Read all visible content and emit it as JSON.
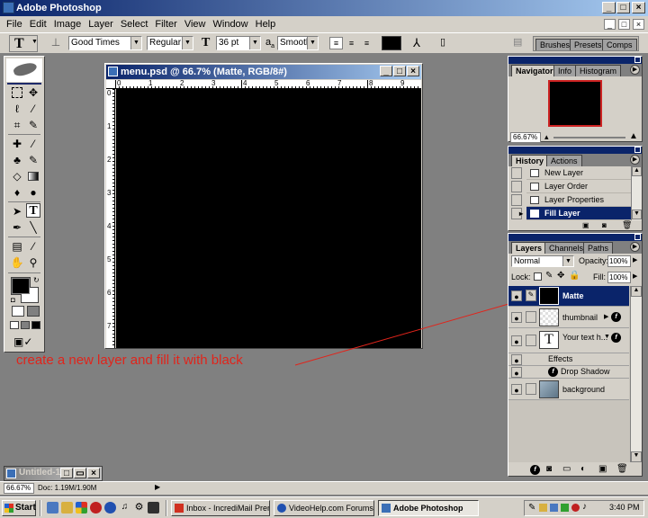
{
  "app": {
    "title": "Adobe Photoshop",
    "menu": [
      "File",
      "Edit",
      "Image",
      "Layer",
      "Select",
      "Filter",
      "View",
      "Window",
      "Help"
    ]
  },
  "options_bar": {
    "tool_glyph": "T",
    "font_family": "Good Times",
    "font_style": "Regular",
    "font_size": "36 pt",
    "aa_label": "a",
    "aa_sub": "a",
    "antialias": "Smooth",
    "text_color": "#000000",
    "palette_tabs": [
      "Brushes",
      "Presets",
      "Comps"
    ]
  },
  "document": {
    "title": "menu.psd @ 66.7% (Matte, RGB/8#)",
    "ruler_h": [
      "0",
      "1",
      "2",
      "3",
      "4",
      "5",
      "6",
      "7",
      "8",
      "9"
    ],
    "ruler_v": [
      "0",
      "1",
      "2",
      "3",
      "4",
      "5",
      "6",
      "7"
    ],
    "canvas_color": "#000000"
  },
  "minimized_doc": {
    "title": "Untitled-1"
  },
  "status_bar": {
    "zoom": "66.67%",
    "doc_size": "Doc: 1.19M/1.90M"
  },
  "annotation": {
    "text": "create a new layer and fill it with black",
    "color": "#e0241b"
  },
  "navigator": {
    "tabs": [
      "Navigator",
      "Info",
      "Histogram"
    ],
    "zoom": "66.67%"
  },
  "history": {
    "tabs": [
      "History",
      "Actions"
    ],
    "items": [
      "New Layer",
      "Layer Order",
      "Layer Properties",
      "Fill Layer"
    ],
    "active_index": 3
  },
  "layers": {
    "tabs": [
      "Layers",
      "Channels",
      "Paths"
    ],
    "blend_mode": "Normal",
    "opacity_label": "Opacity:",
    "opacity": "100%",
    "lock_label": "Lock:",
    "fill_label": "Fill:",
    "fill": "100%",
    "items": [
      {
        "name": "Matte",
        "selected": true
      },
      {
        "name": "thumbnail",
        "selected": false
      },
      {
        "name": "Your text h...",
        "selected": false
      },
      {
        "name": "Effects",
        "selected": false
      },
      {
        "name": "Drop Shadow",
        "selected": false
      },
      {
        "name": "background",
        "selected": false
      }
    ],
    "text_thumb_glyph": "T"
  },
  "taskbar": {
    "start": "Start",
    "buttons": [
      "Inbox - IncrediMail Premium",
      "VideoHelp.com Forums ::...",
      "Adobe Photoshop"
    ],
    "active_index": 2,
    "clock": "3:40 PM"
  }
}
